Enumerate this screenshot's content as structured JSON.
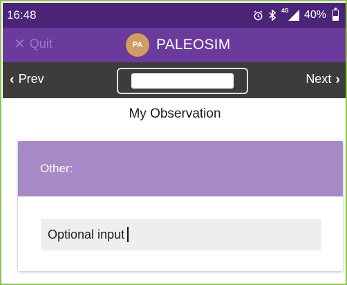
{
  "status_bar": {
    "time": "16:48",
    "alarm_icon": "alarm-clock-icon",
    "bluetooth_icon": "bluetooth-icon",
    "network_label": "4G",
    "signal_icon": "cell-signal-icon",
    "battery_percent": "40%",
    "battery_level": 0.4,
    "background_color": "#4b2478"
  },
  "app_bar": {
    "quit_label": "Quit",
    "quit_icon": "close-icon",
    "logo_text": "PA",
    "app_name": "PALEOSIM",
    "background_color": "#6b3a9d",
    "logo_color": "#d19d62"
  },
  "nav_bar": {
    "prev_label": "Prev",
    "next_label": "Next",
    "center_field_value": "",
    "background_color": "#3c3c3c"
  },
  "main": {
    "title": "My Observation",
    "card": {
      "header_label": "Other:",
      "header_color": "#a789c7",
      "input_value": "Optional input"
    }
  },
  "frame_border_color": "#8bc34a"
}
